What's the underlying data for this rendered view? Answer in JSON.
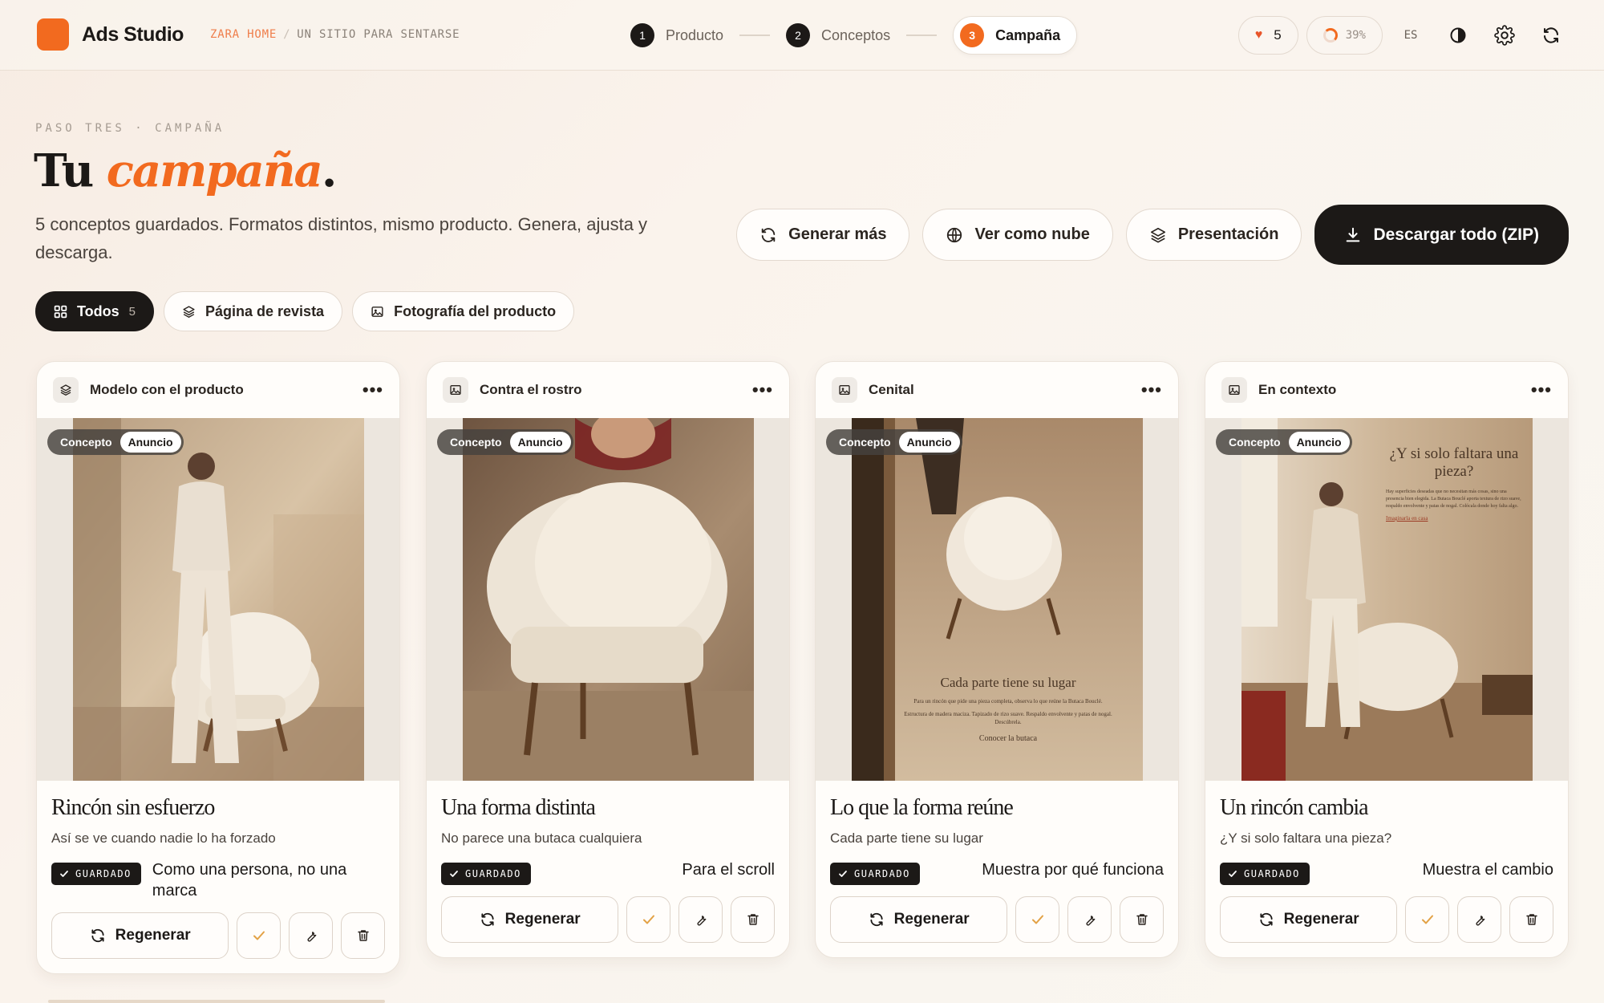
{
  "app": {
    "name": "Ads Studio",
    "breadcrumb": [
      "ZARA HOME",
      "UN SITIO PARA SENTARSE"
    ]
  },
  "steps": [
    {
      "num": "1",
      "label": "Producto",
      "active": false
    },
    {
      "num": "2",
      "label": "Conceptos",
      "active": false
    },
    {
      "num": "3",
      "label": "Campaña",
      "active": true
    }
  ],
  "toolbar": {
    "likes": "5",
    "progress": "39%",
    "progress_value": 0.39,
    "language": "ES",
    "icons": [
      "heart-icon",
      "progress-ring-icon",
      "contrast-icon",
      "settings-gear-icon",
      "refresh-icon"
    ]
  },
  "hero": {
    "eyebrow": "PASO TRES · CAMPAÑA",
    "title_prefix": "Tu",
    "title_accent": "campaña",
    "title_suffix": ".",
    "description": "5 conceptos guardados. Formatos distintos, mismo producto. Genera, ajusta y descarga."
  },
  "actions": {
    "generate_more": "Generar más",
    "view_cloud": "Ver como nube",
    "presentation": "Presentación",
    "download_all": "Descargar todo (ZIP)"
  },
  "filters": [
    {
      "label": "Todos",
      "count": "5",
      "active": true
    },
    {
      "label": "Página de revista",
      "count": "",
      "active": false
    },
    {
      "label": "Fotografía del producto",
      "count": "",
      "active": false
    }
  ],
  "colors": {
    "accent": "#f26a1f",
    "dark": "#1c1917",
    "background": "#f8f1ea"
  },
  "cards": [
    {
      "format": "Modelo con el producto",
      "format_icon": "layers-icon",
      "chip_concept": "Concepto",
      "chip_ad": "Anuncio",
      "title": "Rincón sin esfuerzo",
      "subtitle": "Así se ve cuando nadie lo ha forzado",
      "saved": "GUARDADO",
      "reason": "Como una persona, no una marca",
      "regenerate": "Regenerar",
      "image": "model-with-armchair-photo"
    },
    {
      "format": "Contra el rostro",
      "format_icon": "image-icon",
      "chip_concept": "Concepto",
      "chip_ad": "Anuncio",
      "title": "Una forma distinta",
      "subtitle": "No parece una butaca cualquiera",
      "saved": "GUARDADO",
      "reason": "Para el scroll",
      "regenerate": "Regenerar",
      "image": "armchair-closeup-photo"
    },
    {
      "format": "Cenital",
      "format_icon": "image-icon",
      "chip_concept": "Concepto",
      "chip_ad": "Anuncio",
      "title": "Lo que la forma reúne",
      "subtitle": "Cada parte tiene su lugar",
      "saved": "GUARDADO",
      "reason": "Muestra por qué funciona",
      "regenerate": "Regenerar",
      "image": "overhead-armchair-poster",
      "poster": {
        "headline": "Cada parte tiene su lugar",
        "body1": "Para un rincón que pide una pieza completa, observa lo que reúne la Butaca Bouclé.",
        "body2": "Estructura de madera maciza. Tapizado de rizo suave. Respaldo envolvente y patas de nogal. Descúbrela.",
        "cta": "Conocer la butaca"
      }
    },
    {
      "format": "En contexto",
      "format_icon": "image-icon",
      "chip_concept": "Concepto",
      "chip_ad": "Anuncio",
      "title": "Un rincón cambia",
      "subtitle": "¿Y si solo faltara una pieza?",
      "saved": "GUARDADO",
      "reason": "Muestra el cambio",
      "regenerate": "Regenerar",
      "image": "room-context-poster",
      "poster": {
        "headline": "¿Y si solo faltara una pieza?",
        "body": "Hay superficies deseadas que no necesitan más cosas, sino una presencia bien elegida. La Butaca Bouclé aporta textura de rizo suave, respaldo envolvente y patas de nogal. Colócala donde hoy falta algo.",
        "cta": "Imaginarla en casa"
      }
    }
  ]
}
